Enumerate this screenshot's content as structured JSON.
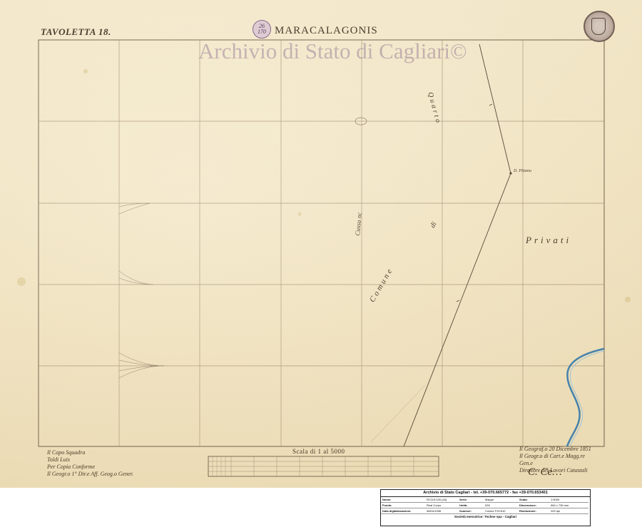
{
  "map": {
    "tavoletta": "TAVOLETTA 18.",
    "title": "MARACALAGONIS",
    "stamp_top": "26",
    "stamp_bottom": "170",
    "watermark": "Archivio di Stato di Cagliari©",
    "scale_label": "Scala di 1 al 5000",
    "labels": {
      "privati": "Privati",
      "comune": "Comune",
      "di": "di",
      "quarto": "Quarto",
      "cussu": "Cussu nc",
      "point": "D. Pittanu"
    },
    "notes_left": [
      "Il Capo Squadra",
      "Toldi Luis",
      "Per Copia Conforme",
      "Il Geogr.o 1° Dir.e Aff. Geog.o Gener."
    ],
    "notes_right": [
      "Il Geograf.o 20 Dicembre 1851",
      "Il Geogr.o di Cart.e Magg.re Gen.e",
      "Direttore dei Lavori Catastali"
    ],
    "signature": "C. Ce…"
  },
  "info_table": {
    "title": "Archivio di Stato Cagliari - tel. +39-070.665772 - fax +39-070.653401",
    "rows": [
      [
        "Nome:",
        "RC119.026 (18)",
        "Serie:",
        "Mappe",
        "Scala:",
        "1:5000"
      ],
      [
        "Fondo:",
        "Real Corpo",
        "Unità:",
        "026",
        "Dimensione:",
        "560 x 736 mm"
      ],
      [
        "Data digitalizzazione:",
        "08/04/1998",
        "Scanner:",
        "Contex FSC610",
        "Risoluzione:",
        "200 dpi"
      ]
    ],
    "footer": "Società esecutrice: Techne spa - Cagliari"
  },
  "colors": {
    "paper": "#f3e6c5",
    "ink": "#3b2a1c",
    "river": "#3a7fb0",
    "watermark": "#967896"
  }
}
